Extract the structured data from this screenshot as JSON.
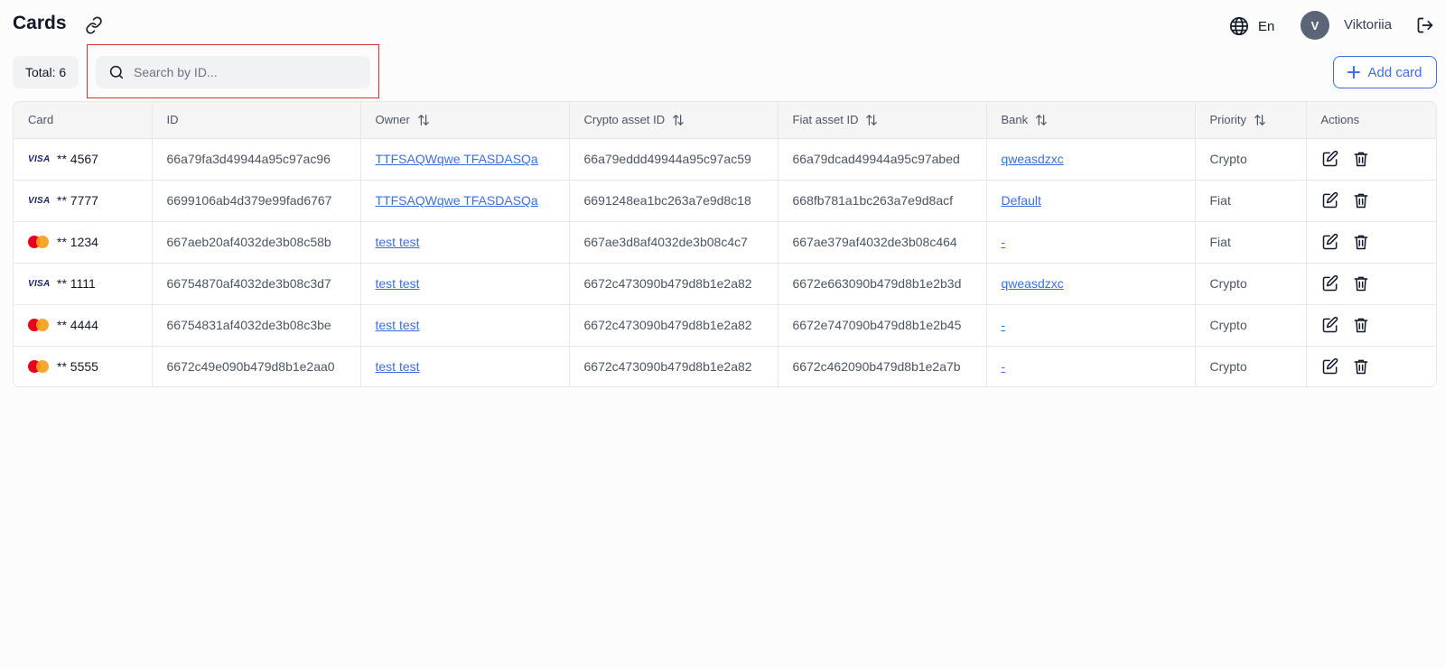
{
  "header": {
    "title": "Cards",
    "language": "En",
    "user_initial": "V",
    "user_name": "Viktoriia"
  },
  "toolbar": {
    "total_label": "Total: 6",
    "search_placeholder": "Search by ID...",
    "add_label": "Add card"
  },
  "colors": {
    "accent": "#3b6fe0",
    "highlight": "#d83030"
  },
  "table": {
    "columns": [
      "Card",
      "ID",
      "Owner",
      "Crypto asset ID",
      "Fiat asset ID",
      "Bank",
      "Priority",
      "Actions"
    ],
    "rows": [
      {
        "brand": "visa",
        "brand_label": "VISA",
        "card": "** 4567",
        "id": "66a79fa3d49944a95c97ac96",
        "owner": "TTFSAQWqwe TFASDASQa",
        "crypto": "66a79eddd49944a95c97ac59",
        "fiat": "66a79dcad49944a95c97abed",
        "bank": "qweasdzxc",
        "priority": "Crypto"
      },
      {
        "brand": "visa",
        "brand_label": "VISA",
        "card": "** 7777",
        "id": "6699106ab4d379e99fad6767",
        "owner": "TTFSAQWqwe TFASDASQa",
        "crypto": "6691248ea1bc263a7e9d8c18",
        "fiat": "668fb781a1bc263a7e9d8acf",
        "bank": "Default",
        "priority": "Fiat"
      },
      {
        "brand": "mastercard",
        "brand_label": "",
        "card": "** 1234",
        "id": "667aeb20af4032de3b08c58b",
        "owner": "test test",
        "crypto": "667ae3d8af4032de3b08c4c7",
        "fiat": "667ae379af4032de3b08c464",
        "bank": "-",
        "priority": "Fiat"
      },
      {
        "brand": "visa",
        "brand_label": "VISA",
        "card": "** 1111",
        "id": "66754870af4032de3b08c3d7",
        "owner": "test test",
        "crypto": "6672c473090b479d8b1e2a82",
        "fiat": "6672e663090b479d8b1e2b3d",
        "bank": "qweasdzxc",
        "priority": "Crypto"
      },
      {
        "brand": "mastercard",
        "brand_label": "",
        "card": "** 4444",
        "id": "66754831af4032de3b08c3be",
        "owner": "test test",
        "crypto": "6672c473090b479d8b1e2a82",
        "fiat": "6672e747090b479d8b1e2b45",
        "bank": "-",
        "priority": "Crypto"
      },
      {
        "brand": "mastercard",
        "brand_label": "",
        "card": "** 5555",
        "id": "6672c49e090b479d8b1e2aa0",
        "owner": "test test",
        "crypto": "6672c473090b479d8b1e2a82",
        "fiat": "6672c462090b479d8b1e2a7b",
        "bank": "-",
        "priority": "Crypto"
      }
    ]
  }
}
